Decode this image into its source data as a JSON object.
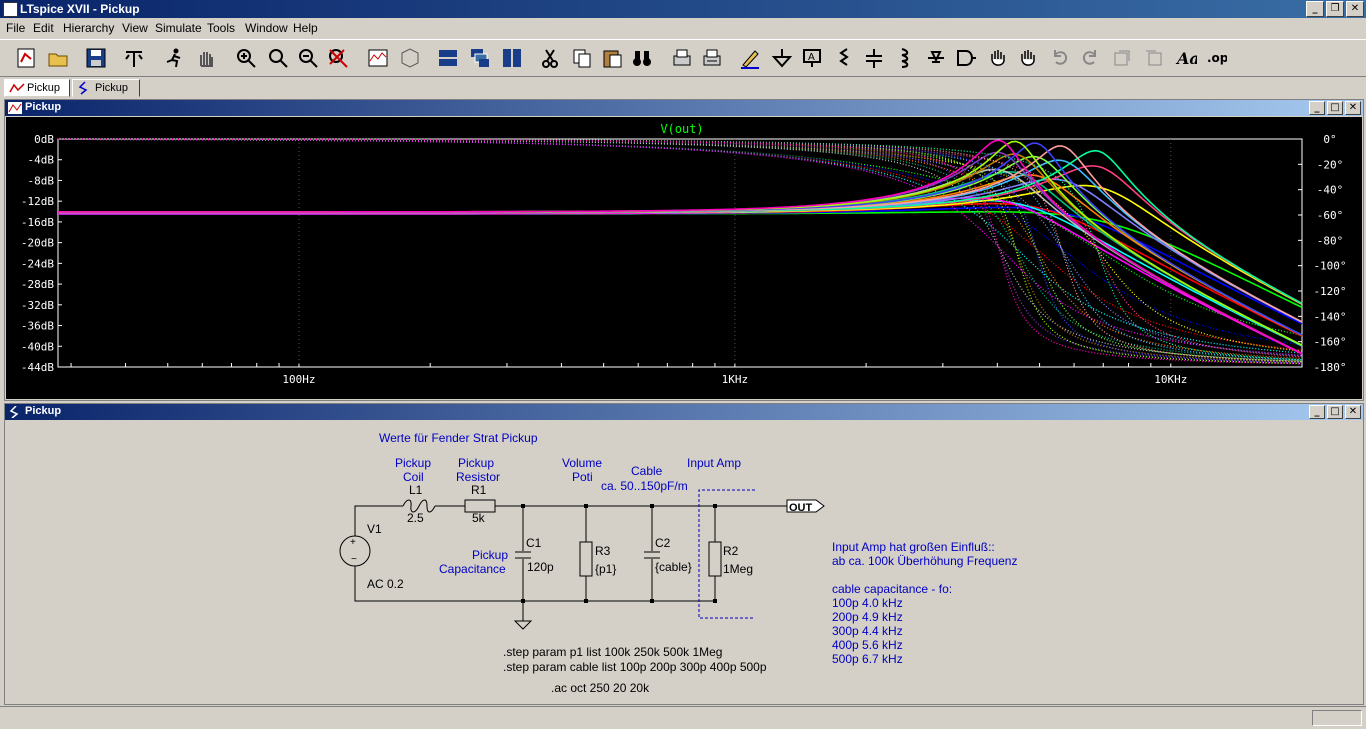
{
  "window": {
    "title": "LTspice XVII - Pickup"
  },
  "menu": [
    "File",
    "Edit",
    "Hierarchy",
    "View",
    "Simulate",
    "Tools",
    "Window",
    "Help"
  ],
  "tabs": [
    {
      "label": "Pickup",
      "icon": "waveform-icon"
    },
    {
      "label": "Pickup",
      "icon": "schematic-icon"
    }
  ],
  "waveform_panel": {
    "title": "Pickup",
    "trace_label": "V(out)",
    "colors": {
      "background": "#000000",
      "grid": "#555555",
      "trace": "#00ff00",
      "axis_text": "#ffffff"
    }
  },
  "chart_data": {
    "type": "line",
    "title": "V(out)",
    "x_scale": "log",
    "xlim": [
      28,
      20000
    ],
    "x_ticks": [
      "100Hz",
      "1KHz",
      "10KHz"
    ],
    "x_tick_values": [
      100,
      1000,
      10000
    ],
    "y_left_ticks": [
      "0dB",
      "-4dB",
      "-8dB",
      "-12dB",
      "-16dB",
      "-20dB",
      "-24dB",
      "-28dB",
      "-32dB",
      "-36dB",
      "-40dB",
      "-44dB"
    ],
    "y_left_lim": [
      -44,
      0
    ],
    "y_right_ticks": [
      "0°",
      "-20°",
      "-40°",
      "-60°",
      "-80°",
      "-100°",
      "-120°",
      "-140°",
      "-160°",
      "-180°"
    ],
    "y_right_lim": [
      -180,
      0
    ],
    "grid": true,
    "series_colors": [
      "#00ff00",
      "#0000ff",
      "#ff0000",
      "#00ffff",
      "#ff00ff",
      "#ffff00",
      "#7f7fff",
      "#ff7f00",
      "#00bf7f",
      "#bfbfbf",
      "#ff3f7f",
      "#3fbfff",
      "#7fff3f",
      "#bf7f00",
      "#7f3fbf",
      "#00ff9f",
      "#ff9f9f",
      "#3f3fff",
      "#9fff00",
      "#ff00bf"
    ],
    "series": [
      {
        "cable_pF": 100,
        "R3": "100k",
        "magnitude": [
          [
            28,
            -15
          ],
          [
            2000,
            -15.2
          ],
          [
            4000,
            -15.8
          ],
          [
            6700,
            -17
          ],
          [
            10000,
            -24
          ],
          [
            20000,
            -34
          ]
        ],
        "phase": [
          [
            28,
            0
          ],
          [
            2000,
            -8
          ],
          [
            5000,
            -35
          ],
          [
            8000,
            -90
          ],
          [
            20000,
            -150
          ]
        ]
      },
      {
        "cable_pF": 500,
        "R3": "1Meg",
        "magnitude": [
          [
            28,
            -15
          ],
          [
            1000,
            -15
          ],
          [
            2000,
            -12
          ],
          [
            3500,
            -4
          ],
          [
            4000,
            -1
          ],
          [
            4500,
            -3
          ],
          [
            6000,
            -18
          ],
          [
            10000,
            -32
          ],
          [
            20000,
            -42
          ]
        ],
        "phase": [
          [
            28,
            0
          ],
          [
            2000,
            -10
          ],
          [
            4000,
            -90
          ],
          [
            6000,
            -160
          ],
          [
            20000,
            -178
          ]
        ]
      }
    ]
  },
  "schematic_panel": {
    "title": "Pickup",
    "heading": "Werte für Fender Strat Pickup",
    "labels": {
      "pickup_coil": [
        "Pickup",
        "Coil"
      ],
      "pickup_resistor": [
        "Pickup",
        "Resistor"
      ],
      "volume_poti": [
        "Volume",
        "Poti"
      ],
      "cable": [
        "Cable",
        "ca. 50..150pF/m"
      ],
      "input_amp": "Input Amp",
      "pickup_cap": [
        "Pickup",
        "Capacitance"
      ]
    },
    "components": {
      "L1": {
        "name": "L1",
        "value": "2.5"
      },
      "R1": {
        "name": "R1",
        "value": "5k"
      },
      "C1": {
        "name": "C1",
        "value": "120p"
      },
      "R3": {
        "name": "R3",
        "value": "{p1}"
      },
      "C2": {
        "name": "C2",
        "value": "{cable}"
      },
      "R2": {
        "name": "R2",
        "value": "1Meg"
      },
      "V1": {
        "name": "V1",
        "value": "AC 0.2"
      }
    },
    "net_out": "OUT",
    "directives": [
      ".step param p1 list 100k 250k 500k 1Meg",
      ".step param cable list 100p 200p 300p 400p 500p",
      ".ac oct 250 20 20k"
    ],
    "notes": [
      "Input Amp hat großen Einfluß::",
      "ab ca. 100k Überhöhung Frequenz",
      "",
      "cable capacitance - fo:",
      "100p  4.0 kHz",
      "200p  4.9 kHz",
      "300p  4.4 kHz",
      "400p  5.6 kHz",
      "500p 6.7 kHz"
    ],
    "colors": {
      "wire": "#000000",
      "text_blue": "#0000c0",
      "text_black": "#000000"
    }
  }
}
